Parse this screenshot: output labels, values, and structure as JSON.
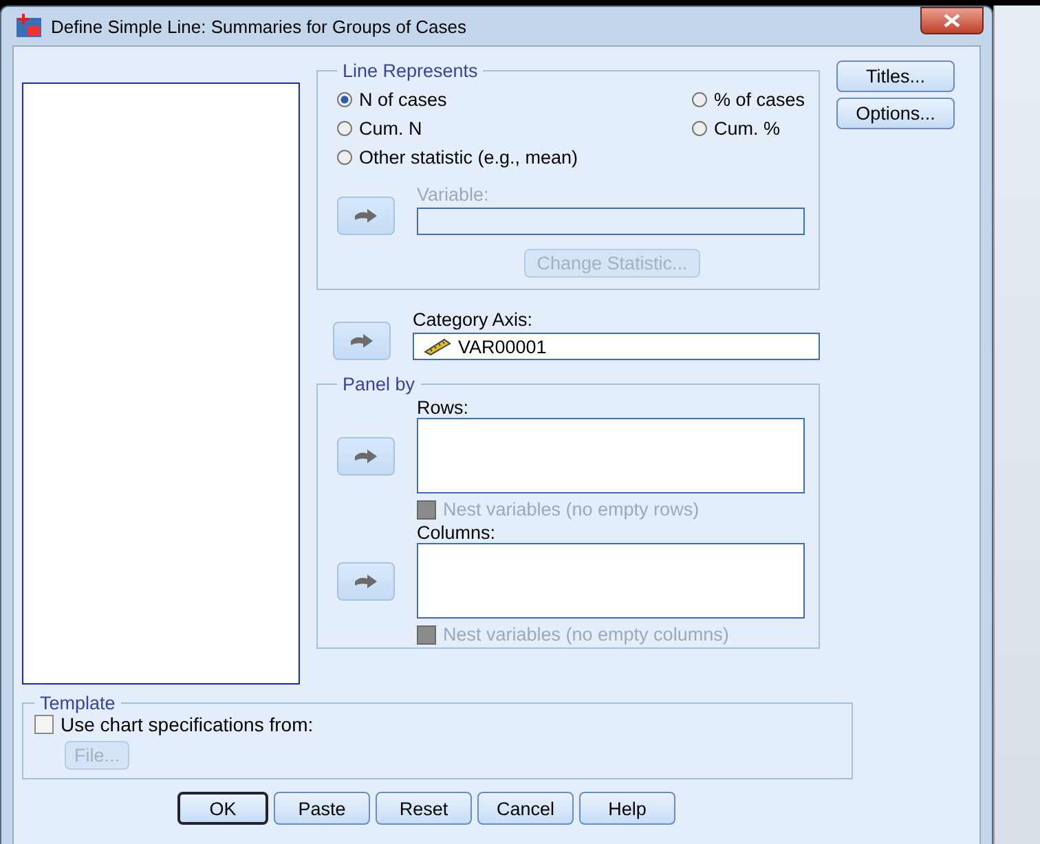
{
  "window": {
    "title": "Define Simple Line: Summaries for Groups of Cases"
  },
  "line_represents": {
    "title": "Line Represents",
    "options": [
      {
        "label": "N of cases",
        "selected": true
      },
      {
        "label": "% of cases",
        "selected": false
      },
      {
        "label": "Cum. N",
        "selected": false
      },
      {
        "label": "Cum. %",
        "selected": false
      },
      {
        "label": "Other statistic (e.g., mean)",
        "selected": false
      }
    ],
    "variable": {
      "label": "Variable:",
      "disabled": true
    },
    "change_statistic": {
      "label": "Change Statistic...",
      "disabled": true
    }
  },
  "category_axis": {
    "label": "Category Axis:",
    "value": "VAR00001"
  },
  "panel_by": {
    "title": "Panel by",
    "rows": {
      "label": "Rows:"
    },
    "nest_rows": {
      "label": "Nest variables (no empty rows)",
      "checked": false,
      "disabled": true
    },
    "columns": {
      "label": "Columns:"
    },
    "nest_columns": {
      "label": "Nest variables (no empty columns)",
      "checked": false,
      "disabled": true
    }
  },
  "template": {
    "title": "Template",
    "use_spec": {
      "label": "Use chart specifications from:",
      "checked": false
    },
    "file_button": {
      "label": "File...",
      "disabled": true
    }
  },
  "side_buttons": [
    "Titles...",
    "Options..."
  ],
  "buttons": [
    {
      "label": "OK",
      "default": true
    },
    {
      "label": "Paste",
      "default": false
    },
    {
      "label": "Reset",
      "default": false
    },
    {
      "label": "Cancel",
      "default": false
    },
    {
      "label": "Help",
      "default": false
    }
  ]
}
